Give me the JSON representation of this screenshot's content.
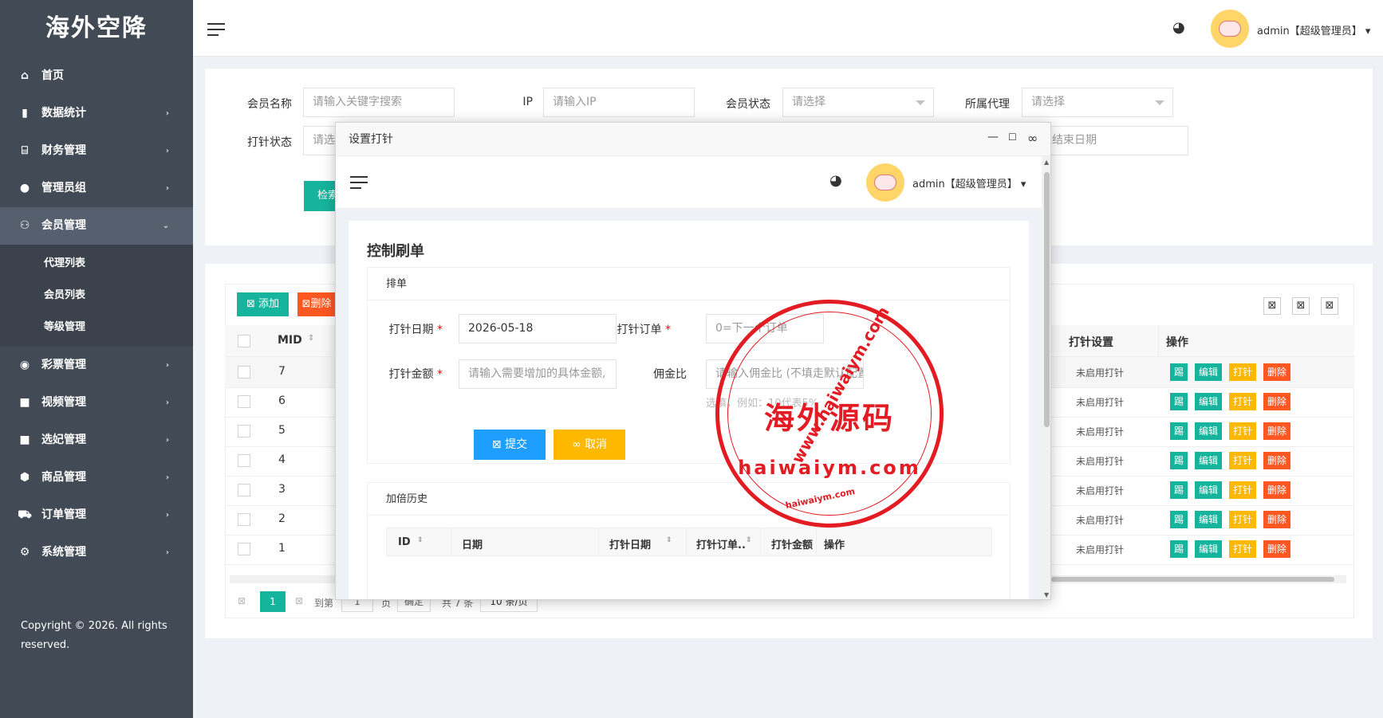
{
  "sidebar": {
    "logo": "海外空降",
    "items": [
      {
        "label": "首页",
        "icon": "home-icon",
        "glyph": "⌂",
        "arrow": ""
      },
      {
        "label": "数据统计",
        "icon": "bar-chart-icon",
        "glyph": "▮",
        "arrow": "›"
      },
      {
        "label": "财务管理",
        "icon": "bank-icon",
        "glyph": "⌸",
        "arrow": "›"
      },
      {
        "label": "管理员组",
        "icon": "user-icon",
        "glyph": "●",
        "arrow": "›"
      },
      {
        "label": "会员管理",
        "icon": "users-icon",
        "glyph": "⚇",
        "arrow": "⌄"
      }
    ],
    "submenu": [
      "代理列表",
      "会员列表",
      "等级管理"
    ],
    "items2": [
      {
        "label": "彩票管理",
        "icon": "gamepad-icon",
        "glyph": "◉",
        "arrow": "›"
      },
      {
        "label": "视频管理",
        "icon": "video-icon",
        "glyph": "■",
        "arrow": "›"
      },
      {
        "label": "选妃管理",
        "icon": "camera-icon",
        "glyph": "■",
        "arrow": "›"
      },
      {
        "label": "商品管理",
        "icon": "cube-icon",
        "glyph": "⬢",
        "arrow": "›"
      },
      {
        "label": "订单管理",
        "icon": "cart-icon",
        "glyph": "⛟",
        "arrow": "›"
      },
      {
        "label": "系统管理",
        "icon": "gear-icon",
        "glyph": "⚙",
        "arrow": "›"
      }
    ],
    "copyright": "Copyright © 2026. All rights reserved."
  },
  "header": {
    "user": "admin【超级管理员】",
    "caret": "▾"
  },
  "search": {
    "member_name_label": "会员名称",
    "member_name_placeholder": "请输入关键字搜索",
    "ip_label": "IP",
    "ip_placeholder": "请输入IP",
    "status_label": "会员状态",
    "status_value": "请选择",
    "agent_label": "所属代理",
    "agent_value": "请选择",
    "pin_status_label": "打针状态",
    "pin_status_value": "请选",
    "end_date_value": "结束日期",
    "search_button": "检索"
  },
  "table": {
    "add_button": "添加",
    "delete_button": "删除",
    "col_mid": "MID",
    "col_pin": "打针设置",
    "col_ops": "操作",
    "rows": [
      {
        "mid": "7",
        "pin": "未启用打针"
      },
      {
        "mid": "6",
        "pin": "未启用打针"
      },
      {
        "mid": "5",
        "pin": "未启用打针"
      },
      {
        "mid": "4",
        "pin": "未启用打针"
      },
      {
        "mid": "3",
        "pin": "未启用打针"
      },
      {
        "mid": "2",
        "pin": "未启用打针"
      },
      {
        "mid": "1",
        "pin": "未启用打针"
      }
    ],
    "ops": {
      "kick": "踢",
      "edit": "编辑",
      "pin": "打针",
      "delete": "删除"
    },
    "pager": {
      "current": "1",
      "goto_label": "到第",
      "page_value": "1",
      "page_unit": "页",
      "confirm": "确定",
      "total": "共 7 条",
      "per_page": "10 条/页"
    }
  },
  "modal": {
    "title": "设置打针",
    "card_title": "控制刷单",
    "section_order": "排单",
    "date_label": "打针日期",
    "date_value": "2026-05-18",
    "order_label": "打针订单",
    "order_placeholder": "0=下一个订单",
    "amount_label": "打针金额",
    "amount_placeholder": "请输入需要增加的具体金额,",
    "commission_label": "佣金比",
    "commission_placeholder": "请输入佣金比 (不填走默认配置",
    "hint": "选填，例如：10代表5%",
    "required_mark": "*",
    "submit_button": "提交",
    "cancel_button": "取消",
    "history_title": "加倍历史",
    "history_cols": [
      "ID",
      "日期",
      "打针日期",
      "打针订单..",
      "打针金额",
      "操作"
    ]
  },
  "watermark": {
    "main": "海外源码",
    "url": "haiwaiym.com",
    "arc_text": "www.haiwaiym.com"
  }
}
